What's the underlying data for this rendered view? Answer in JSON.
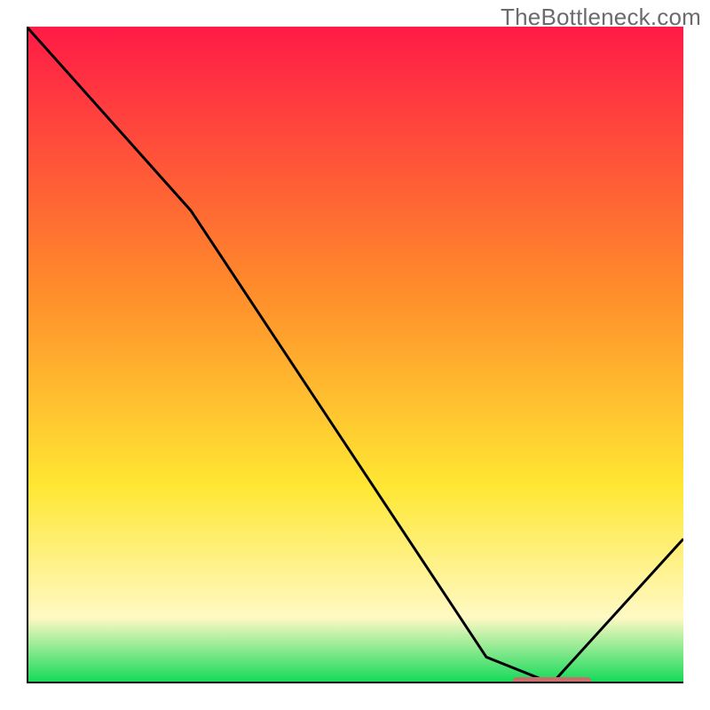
{
  "watermark": "TheBottleneck.com",
  "colors": {
    "gradient_top": "#ff1a47",
    "gradient_orange": "#ff8c2b",
    "gradient_yellow": "#ffe733",
    "gradient_paleyellow": "#fff9c4",
    "gradient_green": "#10d957",
    "curve": "#000000",
    "marker": "#c96d6d",
    "axis": "#000000"
  },
  "chart_data": {
    "type": "line",
    "title": "",
    "xlabel": "",
    "ylabel": "",
    "xlim": [
      0,
      100
    ],
    "ylim": [
      0,
      100
    ],
    "series": [
      {
        "name": "bottleneck-curve",
        "x": [
          0,
          25,
          70,
          80,
          100
        ],
        "y": [
          100,
          72,
          4,
          0,
          22
        ]
      }
    ],
    "marker": {
      "name": "optimal-range",
      "x_start": 74,
      "x_end": 86,
      "y": 0
    },
    "annotations": []
  }
}
